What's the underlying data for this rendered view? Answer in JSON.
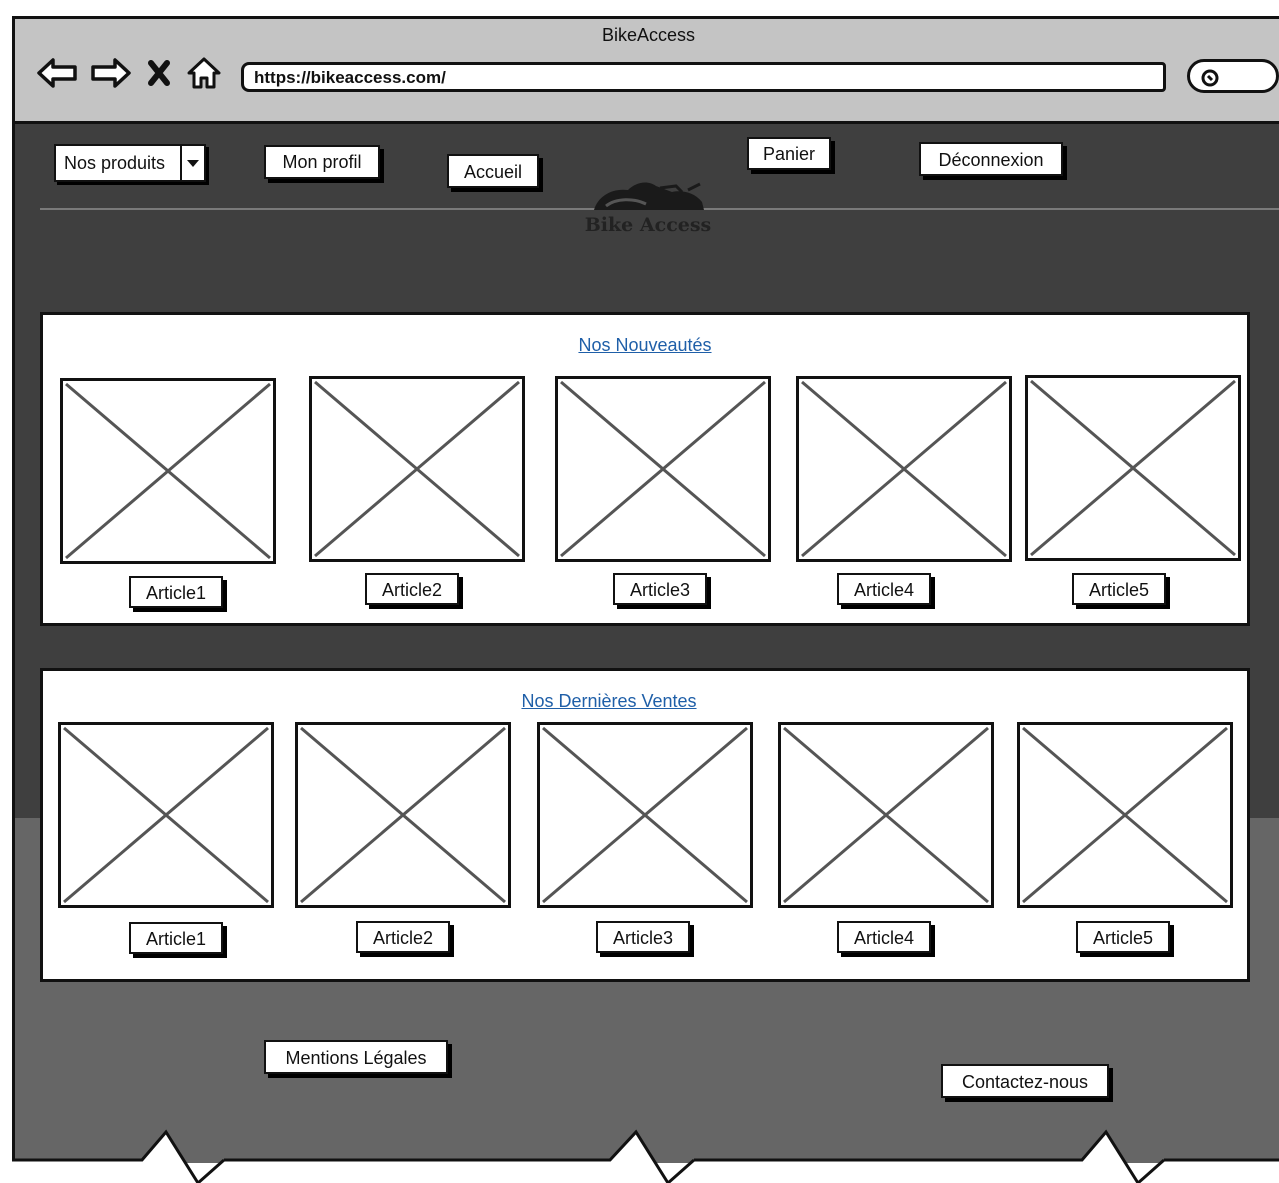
{
  "browser": {
    "title": "BikeAccess",
    "url": "https://bikeaccess.com/"
  },
  "nav": {
    "products_dropdown": "Nos produits",
    "profile": "Mon profil",
    "home": "Accueil",
    "cart": "Panier",
    "logout": "Déconnexion"
  },
  "logo": {
    "text": "Bike Access"
  },
  "new_section": {
    "title": "Nos Nouveautés",
    "articles": [
      "Article1",
      "Article2",
      "Article3",
      "Article4",
      "Article5"
    ]
  },
  "sales_section": {
    "title": "Nos Dernières Ventes",
    "articles": [
      "Article1",
      "Article2",
      "Article3",
      "Article4",
      "Article5"
    ]
  },
  "footer": {
    "legal": "Mentions Légales",
    "contact": "Contactez-nous"
  },
  "colors": {
    "header_bar": "#c4c4c4",
    "page_dark": "#3f3f3f",
    "page_footer": "#666666",
    "link": "#1f5fa8"
  }
}
